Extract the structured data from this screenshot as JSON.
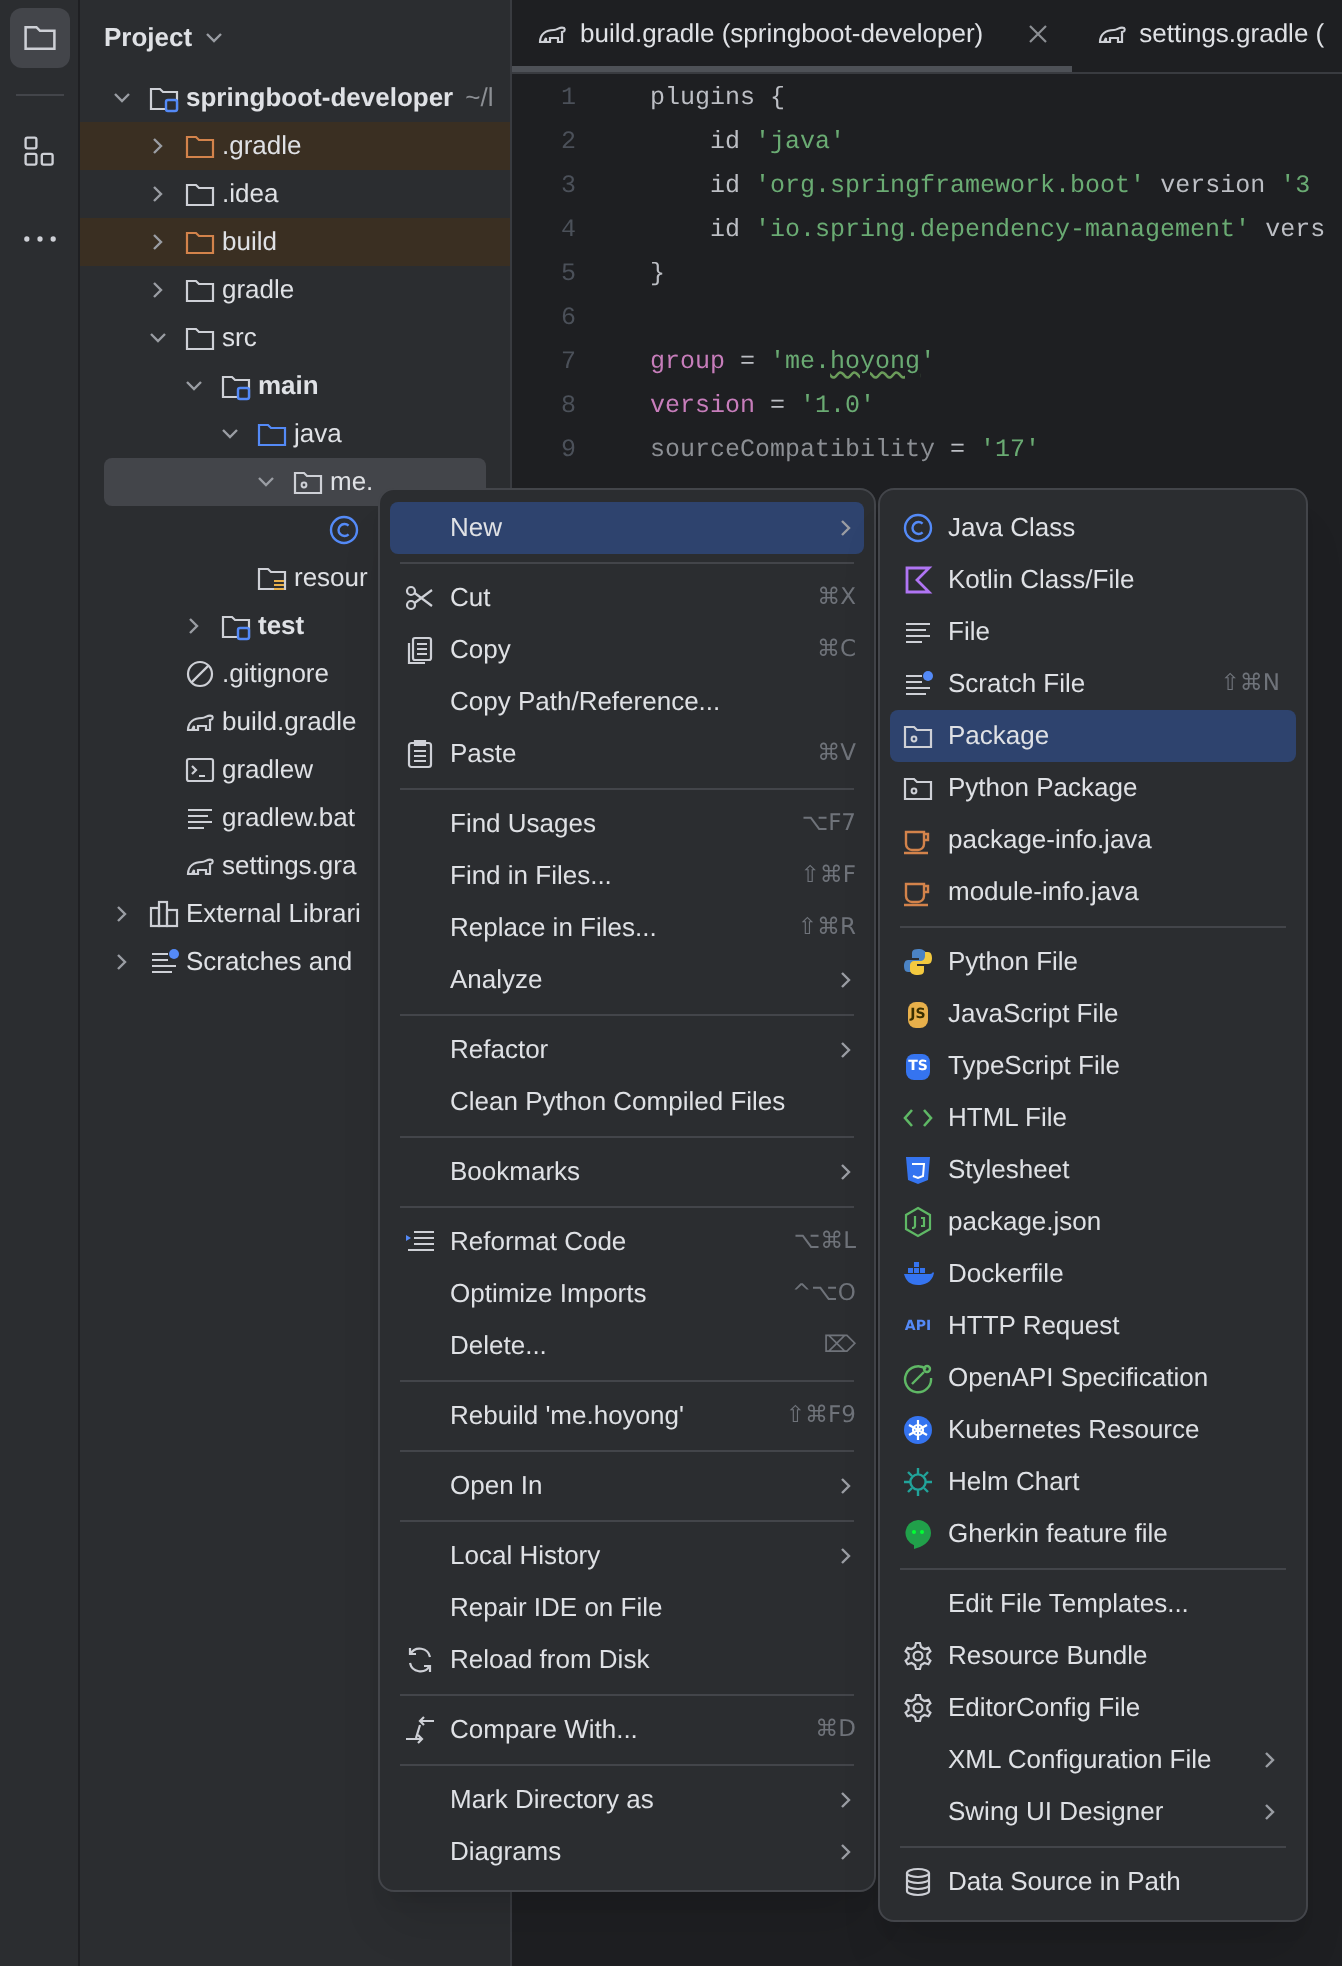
{
  "toolbar": [
    {
      "kind": "project",
      "selected": true
    },
    {
      "kind": "structure",
      "selected": false
    },
    {
      "kind": "more",
      "selected": false
    }
  ],
  "project_panel": {
    "title": "Project",
    "tree": [
      {
        "label": "springboot-developer",
        "path": "~/l",
        "kind": "module",
        "bold": true,
        "expanded": true,
        "selected": false,
        "children": [
          {
            "label": ".gradle",
            "kind": "excluded",
            "expanded": false,
            "selected": false
          },
          {
            "label": ".idea",
            "kind": "folder",
            "expanded": false,
            "selected": false
          },
          {
            "label": "build",
            "kind": "excluded",
            "expanded": false,
            "selected": false
          },
          {
            "label": "gradle",
            "kind": "folder",
            "expanded": false,
            "selected": false
          },
          {
            "label": "src",
            "kind": "folder",
            "expanded": true,
            "selected": false,
            "children": [
              {
                "label": "main",
                "kind": "module",
                "bold": true,
                "expanded": true,
                "selected": false,
                "children": [
                  {
                    "label": "java",
                    "kind": "source",
                    "expanded": true,
                    "selected": false,
                    "children": [
                      {
                        "label": "me.",
                        "kind": "package",
                        "expanded": true,
                        "selected": true,
                        "children": [
                          {
                            "kind": "class",
                            "selected": false
                          }
                        ]
                      }
                    ]
                  },
                  {
                    "label": "resour",
                    "kind": "resources",
                    "selected": false
                  }
                ]
              },
              {
                "label": "test",
                "kind": "module",
                "bold": true,
                "expanded": false,
                "selected": false
              }
            ]
          },
          {
            "label": ".gitignore",
            "kind": "gitignore",
            "selected": false
          },
          {
            "label": "build.gradle",
            "kind": "gradle",
            "selected": false
          },
          {
            "label": "gradlew",
            "kind": "terminal",
            "selected": false
          },
          {
            "label": "gradlew.bat",
            "kind": "text",
            "selected": false
          },
          {
            "label": "settings.gra",
            "kind": "gradle",
            "selected": false
          }
        ]
      },
      {
        "label": "External Librari",
        "kind": "libraries",
        "expanded": false,
        "selected": false
      },
      {
        "label": "Scratches and",
        "kind": "scratches",
        "expanded": false,
        "selected": false
      }
    ]
  },
  "editor": {
    "tabs": [
      {
        "label": "build.gradle (springboot-developer)",
        "selected": true
      },
      {
        "label": "settings.gradle (",
        "selected": false
      }
    ],
    "lines": [
      {
        "number": "1",
        "code": [
          {
            "text": "plugins {",
            "kind": "plain"
          }
        ]
      },
      {
        "number": "2",
        "code": [
          {
            "text": "    id ",
            "kind": "plain"
          },
          {
            "text": "'java'",
            "kind": "string"
          }
        ]
      },
      {
        "number": "3",
        "code": [
          {
            "text": "    id ",
            "kind": "plain"
          },
          {
            "text": "'org.springframework.boot'",
            "kind": "string"
          },
          {
            "text": " version ",
            "kind": "plain"
          },
          {
            "text": "'3",
            "kind": "string"
          }
        ]
      },
      {
        "number": "4",
        "code": [
          {
            "text": "    id ",
            "kind": "plain"
          },
          {
            "text": "'io.spring.dependency-management'",
            "kind": "string"
          },
          {
            "text": " vers",
            "kind": "plain"
          }
        ]
      },
      {
        "number": "5",
        "code": [
          {
            "text": "}",
            "kind": "plain"
          }
        ]
      },
      {
        "number": "6"
      },
      {
        "number": "7",
        "code": [
          {
            "text": "group",
            "kind": "property"
          },
          {
            "text": " = ",
            "kind": "plain"
          },
          {
            "text": "'me.",
            "kind": "string"
          },
          {
            "text": "hoyong",
            "kind": "string",
            "typo": true
          },
          {
            "text": "'",
            "kind": "string"
          }
        ]
      },
      {
        "number": "8",
        "code": [
          {
            "text": "version",
            "kind": "property"
          },
          {
            "text": " = ",
            "kind": "plain"
          },
          {
            "text": "'1.0'",
            "kind": "string"
          }
        ]
      },
      {
        "number": "9",
        "code": [
          {
            "text": "sourceCompatibility",
            "kind": "dim"
          },
          {
            "text": " = ",
            "kind": "plain"
          },
          {
            "text": "'17'",
            "kind": "string"
          }
        ]
      }
    ]
  },
  "context_menu": [
    {
      "kind": "plain",
      "label": "New",
      "submenu": true,
      "selected": true
    },
    {
      "kind": "separator"
    },
    {
      "kind": "cut",
      "label": "Cut",
      "shortcut": "⌘X",
      "selected": false
    },
    {
      "kind": "copy",
      "label": "Copy",
      "shortcut": "⌘C",
      "selected": false
    },
    {
      "kind": "plain",
      "label": "Copy Path/Reference...",
      "selected": false
    },
    {
      "kind": "paste",
      "label": "Paste",
      "shortcut": "⌘V",
      "selected": false
    },
    {
      "kind": "separator"
    },
    {
      "kind": "plain",
      "label": "Find Usages",
      "shortcut": "⌥F7",
      "selected": false
    },
    {
      "kind": "plain",
      "label": "Find in Files...",
      "shortcut": "⇧⌘F",
      "selected": false
    },
    {
      "kind": "plain",
      "label": "Replace in Files...",
      "shortcut": "⇧⌘R",
      "selected": false
    },
    {
      "kind": "plain",
      "label": "Analyze",
      "submenu": true,
      "selected": false
    },
    {
      "kind": "separator"
    },
    {
      "kind": "plain",
      "label": "Refactor",
      "submenu": true,
      "selected": false
    },
    {
      "kind": "plain",
      "label": "Clean Python Compiled Files",
      "selected": false
    },
    {
      "kind": "separator"
    },
    {
      "kind": "plain",
      "label": "Bookmarks",
      "submenu": true,
      "selected": false
    },
    {
      "kind": "separator"
    },
    {
      "kind": "reformat",
      "label": "Reformat Code",
      "shortcut": "⌥⌘L",
      "selected": false
    },
    {
      "kind": "plain",
      "label": "Optimize Imports",
      "shortcut": "^⌥O",
      "selected": false
    },
    {
      "kind": "plain",
      "label": "Delete...",
      "shortcut": "⌦",
      "selected": false
    },
    {
      "kind": "separator"
    },
    {
      "kind": "plain",
      "label": "Rebuild 'me.hoyong'",
      "shortcut": "⇧⌘F9",
      "selected": false
    },
    {
      "kind": "separator"
    },
    {
      "kind": "plain",
      "label": "Open In",
      "submenu": true,
      "selected": false
    },
    {
      "kind": "separator"
    },
    {
      "kind": "plain",
      "label": "Local History",
      "submenu": true,
      "selected": false
    },
    {
      "kind": "plain",
      "label": "Repair IDE on File",
      "selected": false
    },
    {
      "kind": "reload",
      "label": "Reload from Disk",
      "selected": false
    },
    {
      "kind": "separator"
    },
    {
      "kind": "compare",
      "label": "Compare With...",
      "shortcut": "⌘D",
      "selected": false
    },
    {
      "kind": "separator"
    },
    {
      "kind": "plain",
      "label": "Mark Directory as",
      "submenu": true,
      "selected": false
    },
    {
      "kind": "plain",
      "label": "Diagrams",
      "submenu": true,
      "selected": false
    }
  ],
  "new_submenu": [
    {
      "kind": "class",
      "label": "Java Class",
      "selected": false
    },
    {
      "kind": "kotlin",
      "label": "Kotlin Class/File",
      "selected": false
    },
    {
      "kind": "text",
      "label": "File",
      "selected": false
    },
    {
      "kind": "scratches",
      "label": "Scratch File",
      "shortcut": "⇧⌘N",
      "selected": false
    },
    {
      "kind": "package",
      "label": "Package",
      "selected": true
    },
    {
      "kind": "package",
      "label": "Python Package",
      "selected": false
    },
    {
      "kind": "cup",
      "label": "package-info.java",
      "selected": false
    },
    {
      "kind": "cup",
      "label": "module-info.java",
      "selected": false
    },
    {
      "kind": "separator"
    },
    {
      "kind": "python",
      "label": "Python File",
      "selected": false
    },
    {
      "kind": "js",
      "label": "JavaScript File",
      "badge": "JS",
      "selected": false
    },
    {
      "kind": "ts",
      "label": "TypeScript File",
      "badge": "TS",
      "selected": false
    },
    {
      "kind": "html",
      "label": "HTML File",
      "selected": false
    },
    {
      "kind": "css",
      "label": "Stylesheet",
      "selected": false
    },
    {
      "kind": "json",
      "label": "package.json",
      "selected": false
    },
    {
      "kind": "docker",
      "label": "Dockerfile",
      "selected": false
    },
    {
      "kind": "api",
      "label": "HTTP Request",
      "badge": "API",
      "selected": false
    },
    {
      "kind": "openapi",
      "label": "OpenAPI Specification",
      "selected": false
    },
    {
      "kind": "kubernetes",
      "label": "Kubernetes Resource",
      "selected": false
    },
    {
      "kind": "helm",
      "label": "Helm Chart",
      "selected": false
    },
    {
      "kind": "gherkin",
      "label": "Gherkin feature file",
      "selected": false
    },
    {
      "kind": "separator"
    },
    {
      "kind": "plain",
      "label": "Edit File Templates...",
      "selected": false
    },
    {
      "kind": "gear",
      "label": "Resource Bundle",
      "selected": false
    },
    {
      "kind": "gear",
      "label": "EditorConfig File",
      "selected": false
    },
    {
      "kind": "plain",
      "label": "XML Configuration File",
      "submenu": true,
      "selected": false
    },
    {
      "kind": "plain",
      "label": "Swing UI Designer",
      "submenu": true,
      "selected": false
    },
    {
      "kind": "separator"
    },
    {
      "kind": "database",
      "label": "Data Source in Path",
      "selected": false
    }
  ]
}
